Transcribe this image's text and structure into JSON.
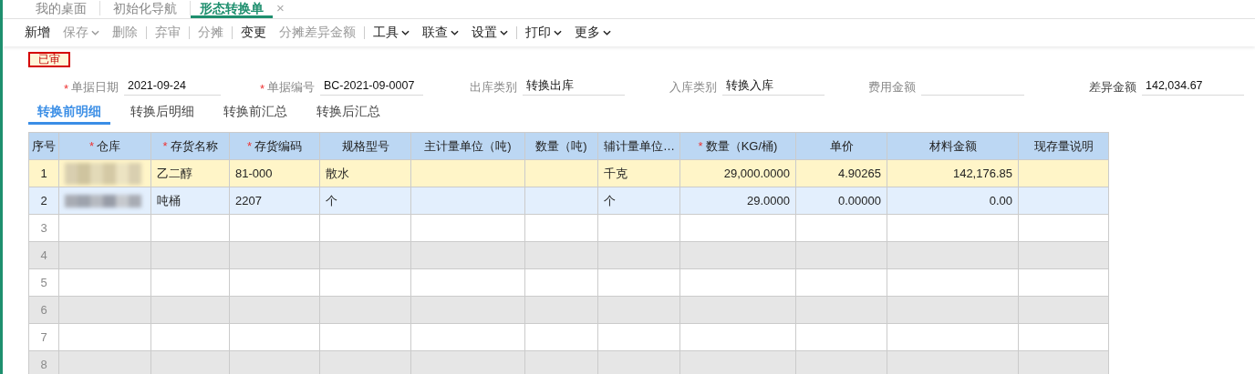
{
  "tabs": [
    {
      "label": "我的桌面",
      "selected": false
    },
    {
      "label": "初始化导航",
      "selected": false
    },
    {
      "label": "形态转换单",
      "selected": true,
      "closable": "×"
    }
  ],
  "toolbar": [
    {
      "label": "新增",
      "disabled": false
    },
    {
      "label": "保存",
      "disabled": true,
      "dropdown": true
    },
    {
      "label": "删除",
      "disabled": true
    },
    {
      "label": "弃审",
      "disabled": true,
      "separator_before": true
    },
    {
      "label": "分摊",
      "disabled": true,
      "separator_before": true
    },
    {
      "label": "变更",
      "disabled": false,
      "separator_before": true
    },
    {
      "label": "分摊差异金额",
      "disabled": true
    },
    {
      "label": "工具",
      "disabled": false,
      "dropdown": true,
      "separator_before": true
    },
    {
      "label": "联查",
      "disabled": false,
      "dropdown": true
    },
    {
      "label": "设置",
      "disabled": false,
      "dropdown": true
    },
    {
      "label": "打印",
      "disabled": false,
      "dropdown": true,
      "separator_before": true
    },
    {
      "label": "更多",
      "disabled": false,
      "dropdown": true
    }
  ],
  "status_badge": "已审",
  "form_fields": [
    {
      "label": "单据日期",
      "required_mark": "*",
      "value": "2021-09-24"
    },
    {
      "label": "单据编号",
      "required_mark": "*",
      "value": "BC-2021-09-0007"
    },
    {
      "label": "出库类别",
      "value": "转换出库"
    },
    {
      "label": "入库类别",
      "value": "转换入库"
    },
    {
      "label": "费用金额"
    },
    {
      "label": "差异金额",
      "value": "142,034.67"
    }
  ],
  "sub_tabs": [
    {
      "label": "转换前明细",
      "selected": true
    },
    {
      "label": "转换后明细",
      "selected": false
    },
    {
      "label": "转换前汇总",
      "selected": false
    },
    {
      "label": "转换后汇总",
      "selected": false
    }
  ],
  "table": {
    "columns": [
      {
        "label": "序号"
      },
      {
        "label": "仓库",
        "required_mark": "*"
      },
      {
        "label": "存货名称",
        "required_mark": "*"
      },
      {
        "label": "存货编码",
        "required_mark": "*"
      },
      {
        "label": "规格型号"
      },
      {
        "label": "主计量单位（吨)"
      },
      {
        "label": "数量（吨)"
      },
      {
        "label": "辅计量单位…"
      },
      {
        "label": "数量（KG/桶)",
        "required_mark": "*"
      },
      {
        "label": "单价"
      },
      {
        "label": "材料金额"
      },
      {
        "label": "现存量说明"
      }
    ],
    "rows": [
      {
        "index": "1",
        "selected": true,
        "hovered": false,
        "cells": [
          {
            "kind": "blurred"
          },
          "乙二醇",
          "81-000",
          "散水",
          "",
          "",
          "千克",
          "29,000.0000",
          "4.90265",
          "142,176.85",
          ""
        ]
      },
      {
        "index": "2",
        "selected": false,
        "hovered": true,
        "cells": [
          {
            "kind": "blurred"
          },
          "吨桶",
          "2207",
          "个",
          "",
          "",
          "个",
          "29.0000",
          "0.00000",
          "0.00",
          ""
        ]
      },
      {
        "index": "3",
        "selected": false,
        "hovered": false
      },
      {
        "index": "4",
        "selected": false,
        "hovered": false
      },
      {
        "index": "5",
        "selected": false,
        "hovered": false
      },
      {
        "index": "6",
        "selected": false,
        "hovered": false
      },
      {
        "index": "7",
        "selected": false,
        "hovered": false
      },
      {
        "index": "8",
        "selected": false,
        "hovered": false
      }
    ]
  }
}
